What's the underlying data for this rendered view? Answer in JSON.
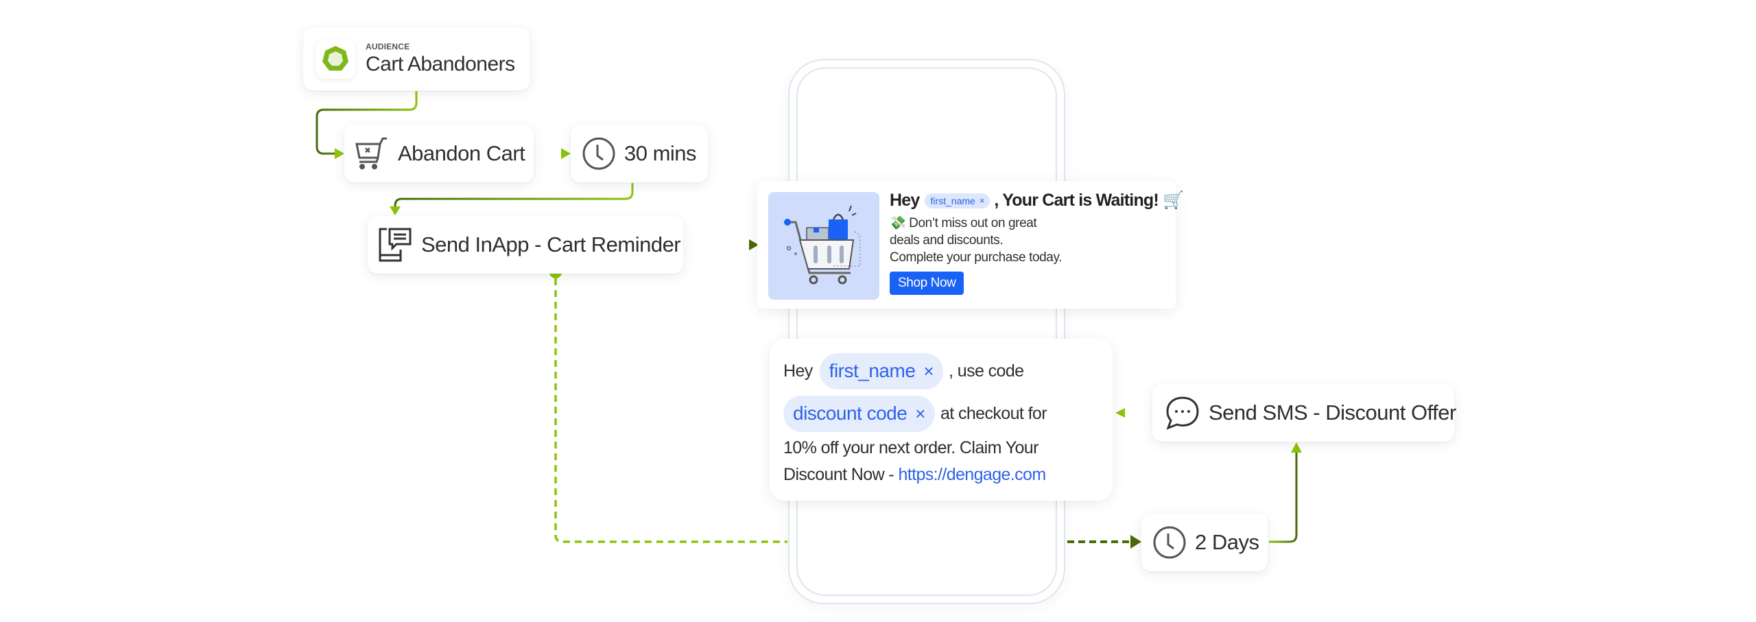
{
  "audience": {
    "kicker": "AUDIENCE",
    "title": "Cart Abandoners",
    "icon": "heptagon-audience-icon"
  },
  "nodes": {
    "abandon_cart": {
      "label": "Abandon Cart",
      "icon": "cart-remove-icon"
    },
    "wait_30": {
      "label": "30 mins",
      "icon": "clock-icon"
    },
    "send_inapp": {
      "label": "Send InApp  - Cart Reminder",
      "icon": "mobile-message-icon"
    },
    "send_sms": {
      "label": "Send SMS - Discount Offer",
      "icon": "chat-bubble-icon"
    },
    "wait_2d": {
      "label": "2 Days",
      "icon": "clock-icon"
    }
  },
  "inapp_card": {
    "title_prefix": "Hey",
    "chip": "first_name",
    "chip_remove": "×",
    "title_suffix": ", Your Cart is Waiting! 🛒",
    "line1": "💸 Don’t miss out on great",
    "line2": "deals and discounts.",
    "line3": "Complete your purchase today.",
    "button": "Shop Now"
  },
  "sms_card": {
    "prefix": "Hey",
    "chip1": "first_name",
    "mid": ", use code",
    "chip2": "discount code",
    "after_chip2": "at checkout for",
    "line3": "10% off your next order. Claim Your",
    "line4_prefix": "Discount Now - ",
    "link": "https://dengage.com",
    "chip_remove": "×"
  },
  "colors": {
    "green_light": "#8cc40a",
    "green_dark": "#4a6a0a",
    "chip_bg": "#e5edfd",
    "chip_text": "#2d62e8",
    "button_blue": "#1962f5",
    "phone_border": "#dde6ee"
  }
}
